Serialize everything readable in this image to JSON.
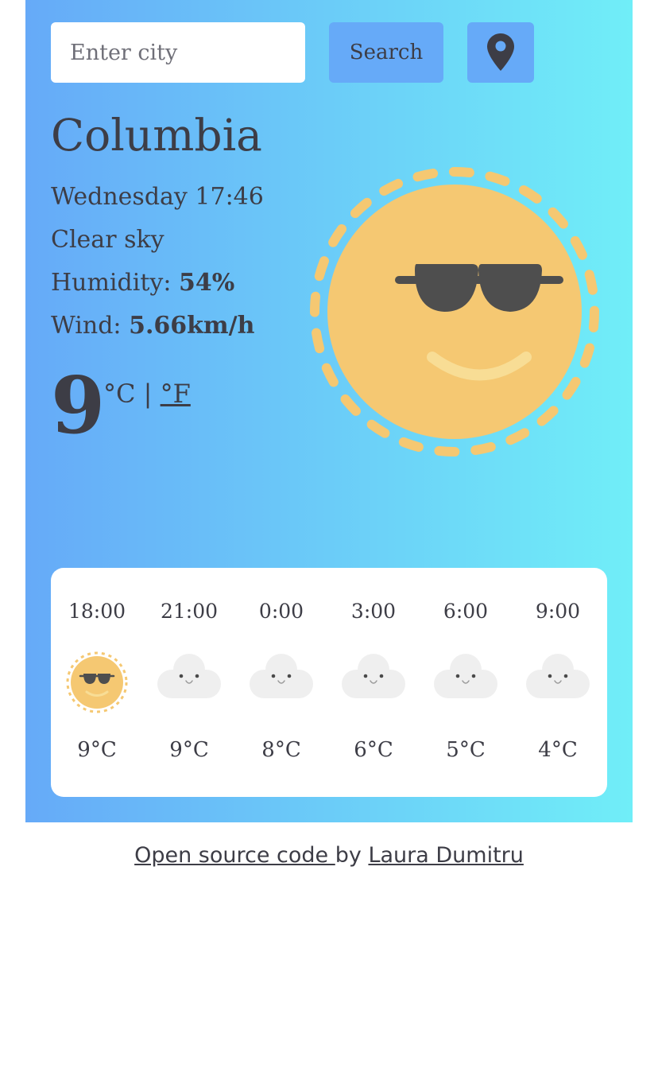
{
  "search": {
    "placeholder": "Enter city",
    "value": "",
    "button_label": "Search",
    "location_icon": "map-pin-icon"
  },
  "weather": {
    "city": "Columbia",
    "date": "Wednesday 17:46",
    "description": "Clear sky",
    "humidity_label": "Humidity: ",
    "humidity_value": "54%",
    "wind_label": "Wind: ",
    "wind_value": "5.66km/h",
    "temperature": "9",
    "unit_c": "°C",
    "unit_separator": "|",
    "unit_f": "°F",
    "icon": "sun-sunglasses-icon"
  },
  "forecast": [
    {
      "time": "18:00",
      "temp": "9°C",
      "icon": "sun-sunglasses-icon"
    },
    {
      "time": "21:00",
      "temp": "9°C",
      "icon": "cloud-icon"
    },
    {
      "time": "0:00",
      "temp": "8°C",
      "icon": "cloud-icon"
    },
    {
      "time": "3:00",
      "temp": "6°C",
      "icon": "cloud-icon"
    },
    {
      "time": "6:00",
      "temp": "5°C",
      "icon": "cloud-icon"
    },
    {
      "time": "9:00",
      "temp": "4°C",
      "icon": "cloud-icon"
    }
  ],
  "footer": {
    "source_link": "Open source code ",
    "by": "by ",
    "author_link": "Laura Dumitru"
  },
  "colors": {
    "gradient_start": "#66aaf8",
    "gradient_end": "#70eef8",
    "button": "#66aaf8",
    "sun": "#f5c872",
    "text": "#3d3d46",
    "cloud": "#efefef"
  }
}
